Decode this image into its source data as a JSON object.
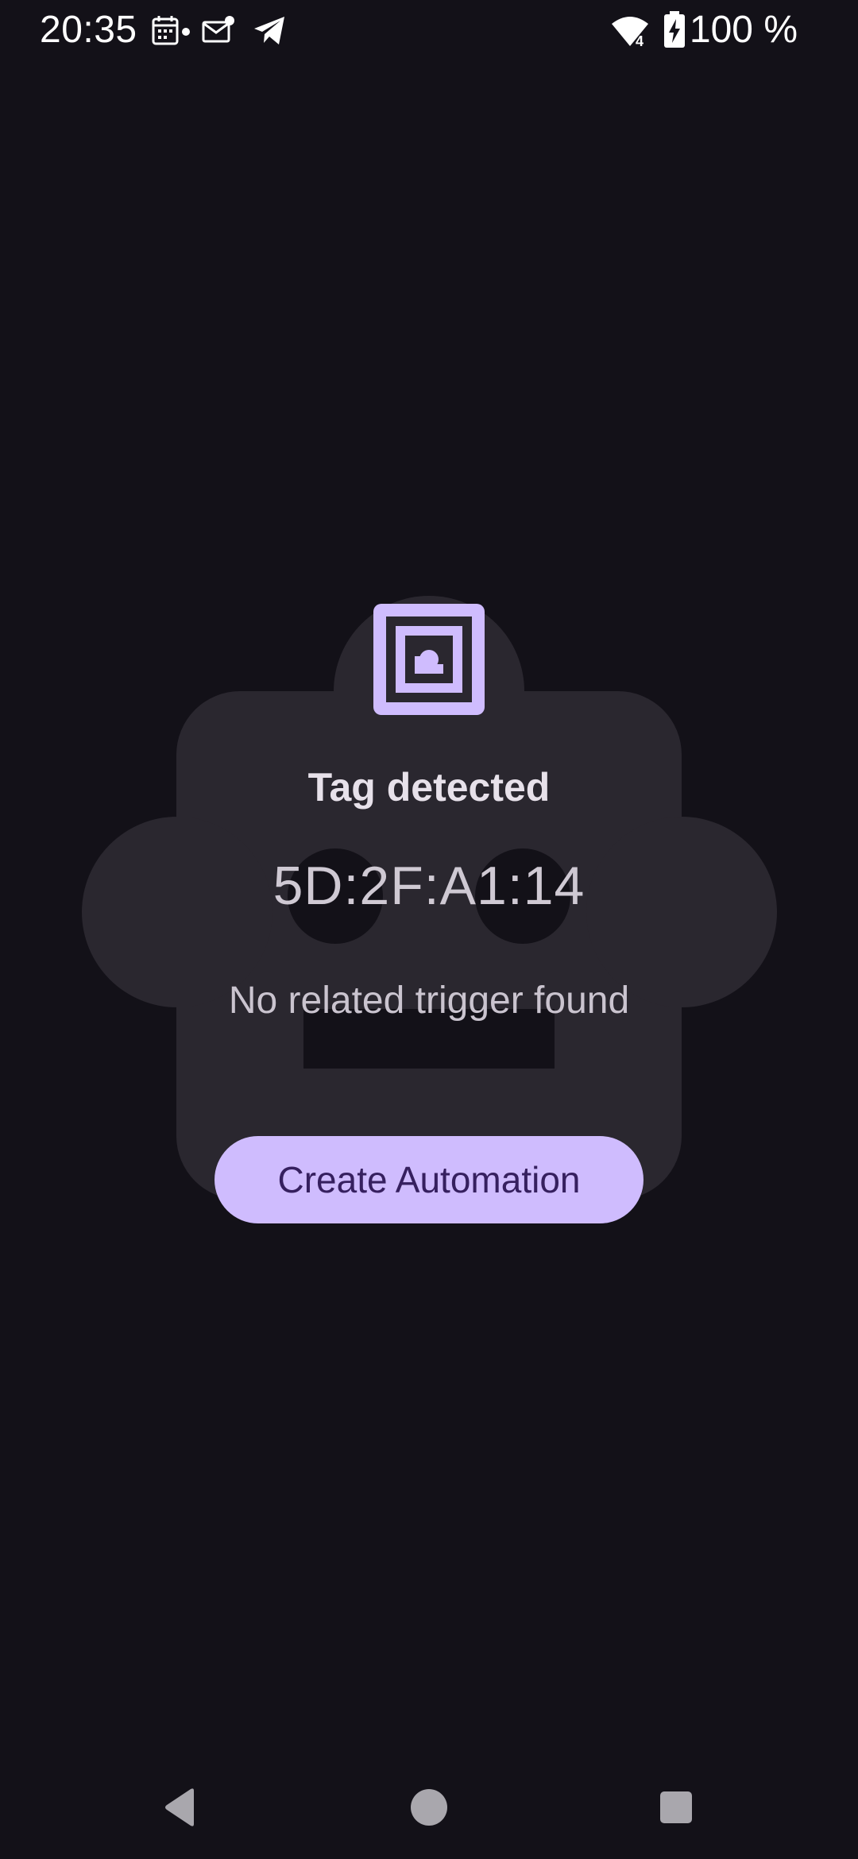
{
  "status_bar": {
    "time": "20:35",
    "battery_text": "100 %",
    "icons": [
      "calendar-icon",
      "notification-dot",
      "mail-icon",
      "telegram-icon",
      "wifi-icon",
      "battery-charging-icon"
    ]
  },
  "dialog": {
    "icon": "nfc-icon",
    "title": "Tag detected",
    "tag_id": "5D:2F:A1:14",
    "message": "No related trigger found",
    "button_label": "Create Automation"
  },
  "navigation": {
    "buttons": [
      "back-icon",
      "home-icon",
      "recents-icon"
    ]
  },
  "colors": {
    "background": "#131118",
    "backdrop_shape": "#2a272f",
    "accent": "#cfbcfe",
    "button_text": "#36205f"
  }
}
